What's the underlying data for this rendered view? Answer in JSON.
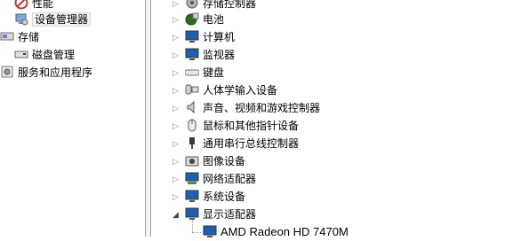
{
  "left_tree": [
    {
      "name": "tree-item-performance",
      "label": "性能",
      "icon": "no-sign-icon"
    },
    {
      "name": "tree-item-device-manager",
      "label": "设备管理器",
      "icon": "device-manager-icon",
      "selected": true
    },
    {
      "name": "tree-item-storage",
      "label": "存储",
      "icon": "storage-icon"
    },
    {
      "name": "tree-item-disk-management",
      "label": "磁盘管理",
      "icon": "disk-icon"
    },
    {
      "name": "tree-item-services-apps",
      "label": "服务和应用程序",
      "icon": "services-icon"
    }
  ],
  "device_categories": [
    {
      "name": "storage-controllers",
      "label": "存储控制器",
      "icon": "storage-controller-icon"
    },
    {
      "name": "battery",
      "label": "电池",
      "icon": "battery-icon"
    },
    {
      "name": "computer",
      "label": "计算机",
      "icon": "computer-icon"
    },
    {
      "name": "monitors",
      "label": "监视器",
      "icon": "monitor-icon"
    },
    {
      "name": "keyboards",
      "label": "键盘",
      "icon": "keyboard-icon"
    },
    {
      "name": "hid",
      "label": "人体学输入设备",
      "icon": "hid-icon"
    },
    {
      "name": "sound",
      "label": "声音、视频和游戏控制器",
      "icon": "speaker-icon"
    },
    {
      "name": "mice",
      "label": "鼠标和其他指针设备",
      "icon": "mouse-icon"
    },
    {
      "name": "usb",
      "label": "通用串行总线控制器",
      "icon": "usb-icon"
    },
    {
      "name": "imaging",
      "label": "图像设备",
      "icon": "camera-icon"
    },
    {
      "name": "network",
      "label": "网络适配器",
      "icon": "network-icon"
    },
    {
      "name": "system",
      "label": "系统设备",
      "icon": "system-device-icon"
    },
    {
      "name": "display",
      "label": "显示适配器",
      "icon": "display-adapter-icon",
      "expanded": true
    }
  ],
  "display_child": {
    "label": "AMD Radeon HD 7470M",
    "icon": "display-adapter-icon"
  },
  "colors": {
    "monitor_blue": "#1e5fb4",
    "selection_bg": "#f3f3f3",
    "line": "#a0a0a0"
  }
}
